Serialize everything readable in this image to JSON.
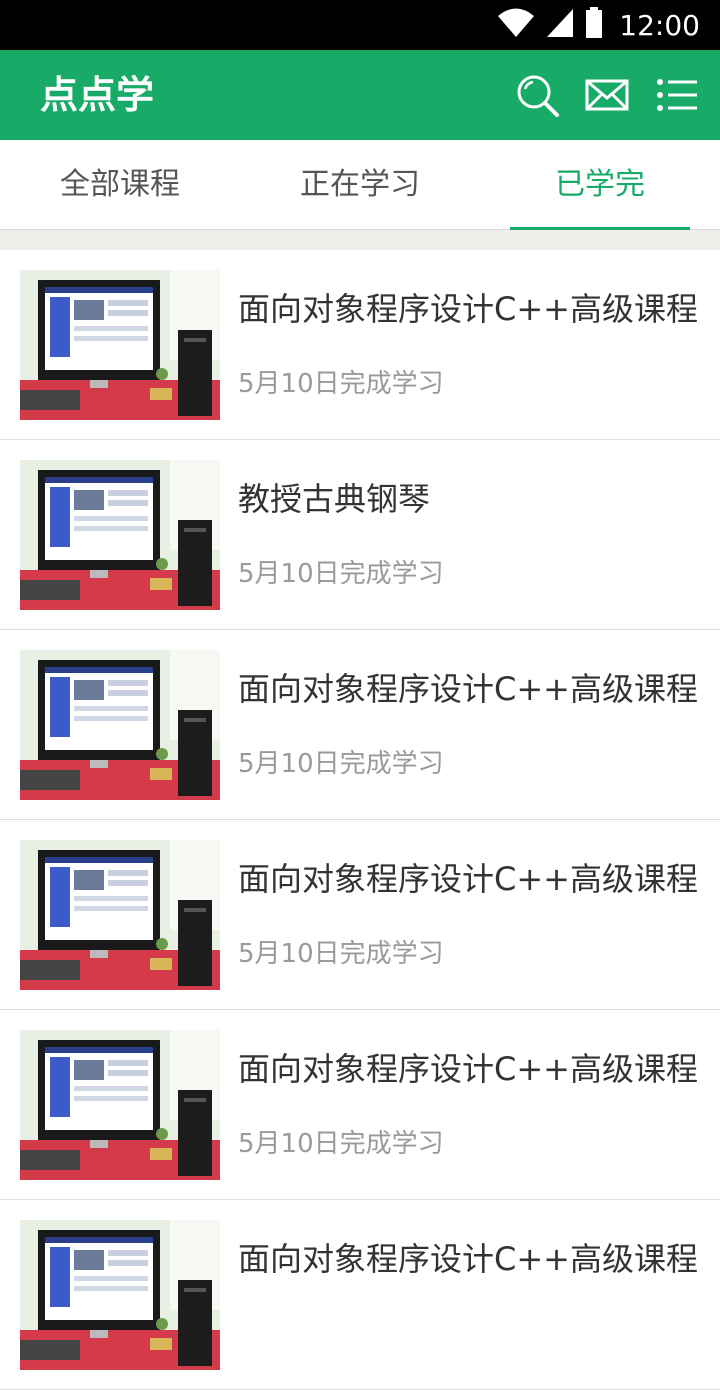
{
  "status_bar": {
    "time": "12:00"
  },
  "app_bar": {
    "title": "点点学",
    "icons": [
      "search-icon",
      "mail-icon",
      "menu-list-icon"
    ]
  },
  "tabs": [
    {
      "label": "全部课程",
      "active": false
    },
    {
      "label": "正在学习",
      "active": false
    },
    {
      "label": "已学完",
      "active": true
    }
  ],
  "courses": [
    {
      "title": "面向对象程序设计C++高级课程",
      "status": "5月10日完成学习"
    },
    {
      "title": "教授古典钢琴",
      "status": "5月10日完成学习"
    },
    {
      "title": "面向对象程序设计C++高级课程",
      "status": "5月10日完成学习"
    },
    {
      "title": "面向对象程序设计C++高级课程",
      "status": "5月10日完成学习"
    },
    {
      "title": "面向对象程序设计C++高级课程",
      "status": "5月10日完成学习"
    },
    {
      "title": "面向对象程序设计C++高级课程",
      "status": ""
    }
  ],
  "colors": {
    "primary": "#17ab67",
    "status_bar": "#000000",
    "divider": "#efefeb"
  }
}
